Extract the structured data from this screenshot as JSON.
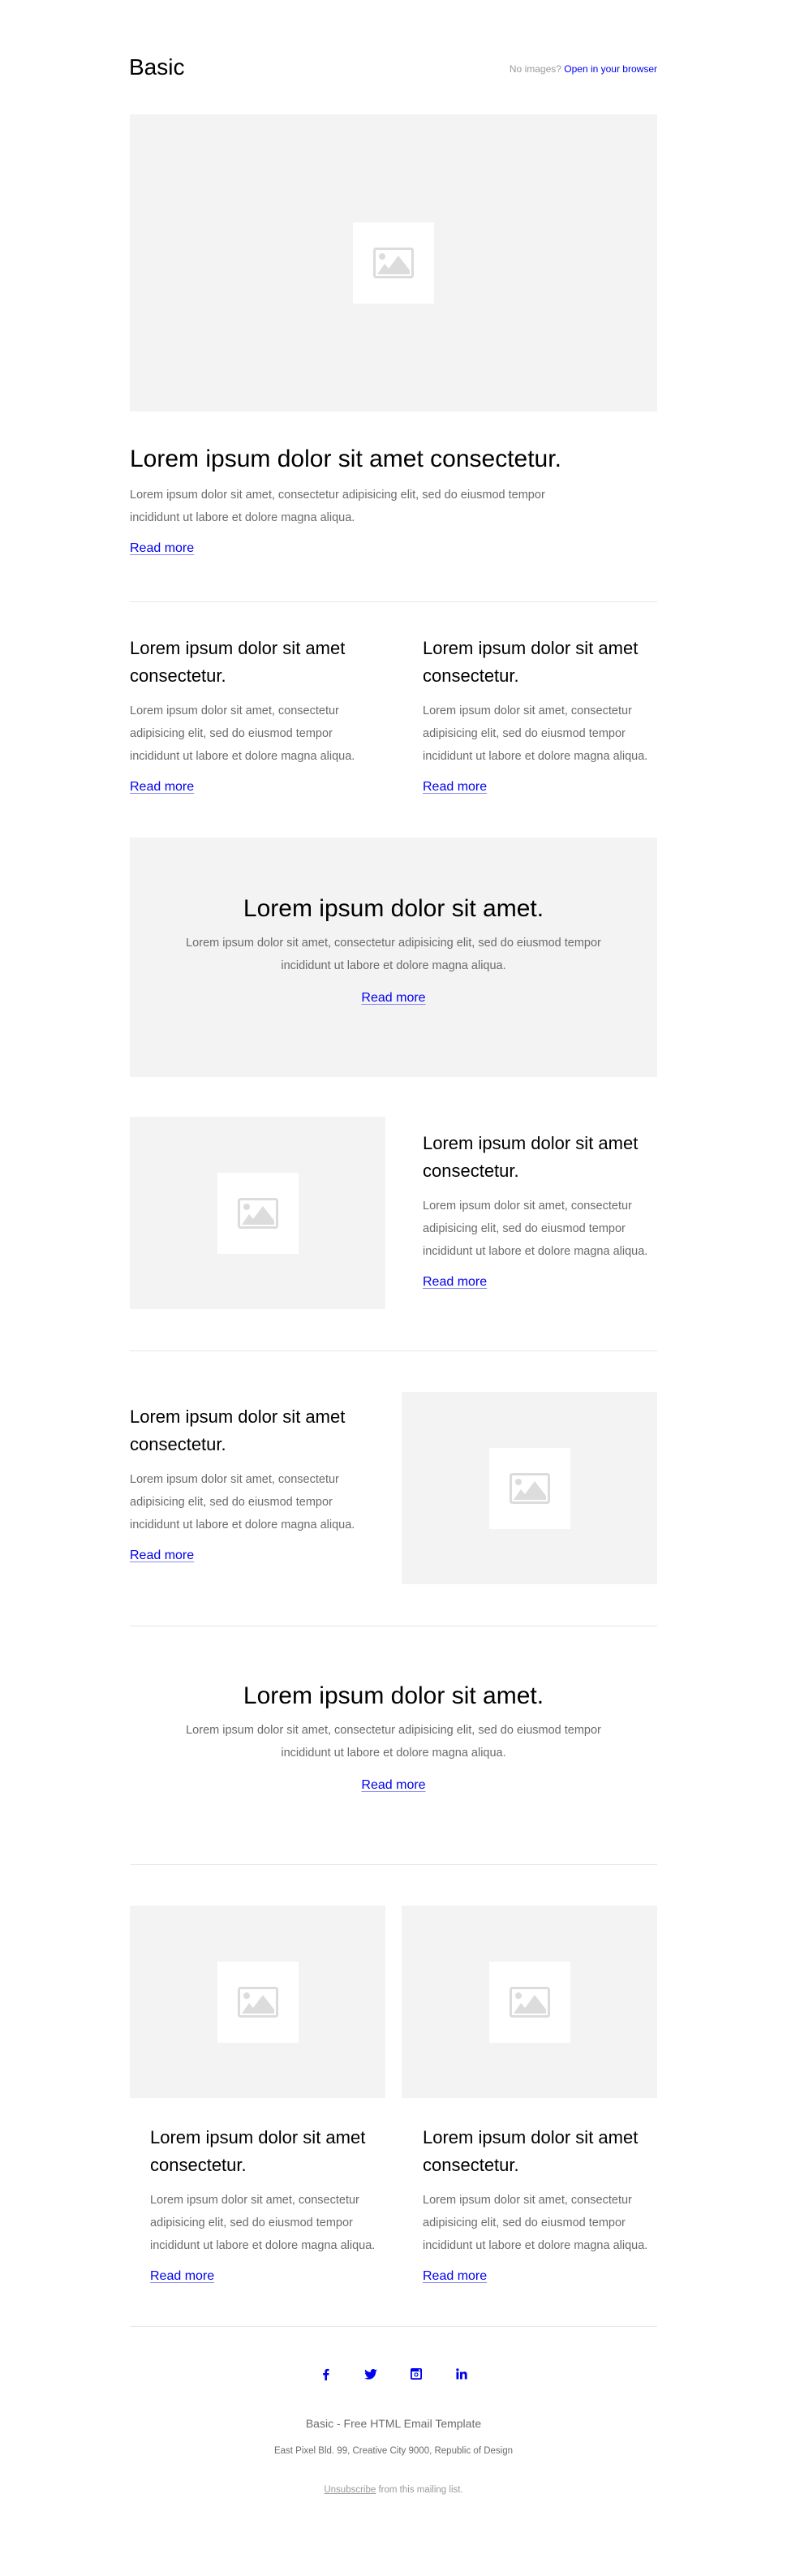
{
  "header": {
    "brand": "Basic",
    "no_images_text": "No images?",
    "open_browser_link": "Open in your browser"
  },
  "hero": {
    "image": "image-placeholder-icon"
  },
  "article_main": {
    "title": "Lorem ipsum dolor sit amet consectetur.",
    "body": "Lorem ipsum dolor sit amet, consectetur adipisicing elit, sed do eiusmod tempor incididunt ut labore et dolore magna aliqua.",
    "link": "Read more"
  },
  "two_columns": [
    {
      "title": "Lorem ipsum dolor sit amet consectetur.",
      "body": "Lorem ipsum dolor sit amet, consectetur adipisicing elit, sed do eiusmod tempor incididunt ut labore et dolore magna aliqua.",
      "link": "Read more"
    },
    {
      "title": "Lorem ipsum dolor sit amet consectetur.",
      "body": "Lorem ipsum dolor sit amet, consectetur adipisicing elit, sed do eiusmod tempor incididunt ut labore et dolore magna aliqua.",
      "link": "Read more"
    }
  ],
  "banner": {
    "title": "Lorem ipsum dolor sit amet.",
    "body": "Lorem ipsum dolor sit amet, consectetur adipisicing elit, sed do eiusmod tempor incididunt ut labore et dolore magna aliqua.",
    "link": "Read more"
  },
  "image_left_row": {
    "title": "Lorem ipsum dolor sit amet consectetur.",
    "body": "Lorem ipsum dolor sit amet, consectetur adipisicing elit, sed do eiusmod tempor incididunt ut labore et dolore magna aliqua.",
    "link": "Read more"
  },
  "image_right_row": {
    "title": "Lorem ipsum dolor sit amet consectetur.",
    "body": "Lorem ipsum dolor sit amet, consectetur adipisicing elit, sed do eiusmod tempor incididunt ut labore et dolore magna aliqua.",
    "link": "Read more"
  },
  "centered_block": {
    "title": "Lorem ipsum dolor sit amet.",
    "body": "Lorem ipsum dolor sit amet, consectetur adipisicing elit, sed do eiusmod tempor incididunt ut labore et dolore magna aliqua.",
    "link": "Read more"
  },
  "image_grid": [
    {
      "title": "Lorem ipsum dolor sit amet consectetur.",
      "body": "Lorem ipsum dolor sit amet, consectetur adipisicing elit, sed do eiusmod tempor incididunt ut labore et dolore magna aliqua.",
      "link": "Read more"
    },
    {
      "title": "Lorem ipsum dolor sit amet consectetur.",
      "body": "Lorem ipsum dolor sit amet, consectetur adipisicing elit, sed do eiusmod tempor incididunt ut labore et dolore magna aliqua.",
      "link": "Read more"
    }
  ],
  "footer": {
    "social": [
      {
        "name": "facebook-icon",
        "glyph": "f"
      },
      {
        "name": "twitter-icon",
        "glyph": "t"
      },
      {
        "name": "instagram-icon",
        "glyph": "i"
      },
      {
        "name": "linkedin-icon",
        "glyph": "in"
      }
    ],
    "title": "Basic - Free HTML Email Template",
    "address": "East Pixel Bld. 99, Creative City 9000, Republic of Design",
    "unsubscribe_link": "Unsubscribe",
    "unsubscribe_rest": " from this mailing list."
  },
  "colors": {
    "link": "#0000ee",
    "body_text": "#6b6b6b",
    "panel": "#f3f3f3",
    "divider": "#e6e6e6"
  }
}
